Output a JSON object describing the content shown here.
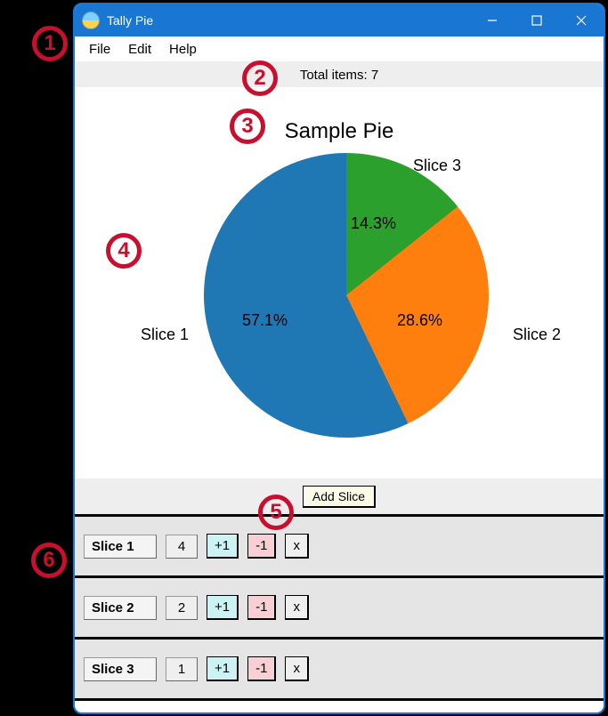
{
  "window": {
    "title": "Tally Pie"
  },
  "menubar": [
    "File",
    "Edit",
    "Help"
  ],
  "total_label": "Total items: 7",
  "chart_data": {
    "type": "pie",
    "title": "Sample Pie",
    "series": [
      {
        "name": "Slice 1",
        "value": 4,
        "percent": "57.1%",
        "color": "#1f77b4"
      },
      {
        "name": "Slice 2",
        "value": 2,
        "percent": "28.6%",
        "color": "#ff7f0e"
      },
      {
        "name": "Slice 3",
        "value": 1,
        "percent": "14.3%",
        "color": "#2ca02c"
      }
    ]
  },
  "add_button_label": "Add Slice",
  "row_buttons": {
    "inc": "+1",
    "dec": "-1",
    "del": "x"
  },
  "slice_rows": [
    {
      "name": "Slice 1",
      "count": "4"
    },
    {
      "name": "Slice 2",
      "count": "2"
    },
    {
      "name": "Slice 3",
      "count": "1"
    }
  ],
  "annotations": [
    "1",
    "2",
    "3",
    "4",
    "5",
    "6"
  ]
}
